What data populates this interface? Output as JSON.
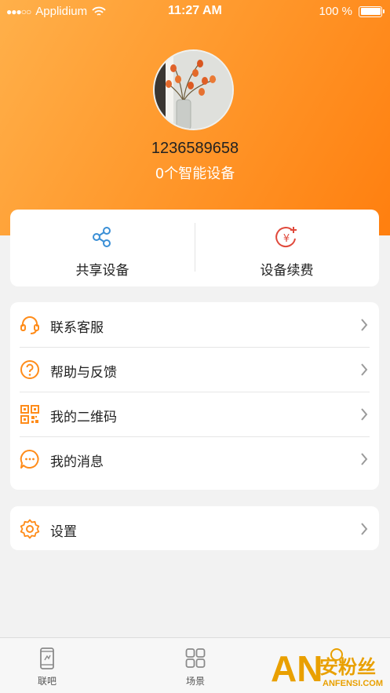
{
  "status_bar": {
    "signal_dots": "●●●○○",
    "carrier": "Applidium",
    "time": "11:27 AM",
    "battery": "100 %",
    "battery_level": 1.0
  },
  "profile": {
    "phone": "1236589658",
    "device_count": "0个智能设备"
  },
  "actions": [
    {
      "label": "共享设备",
      "icon": "share-icon"
    },
    {
      "label": "设备续费",
      "icon": "yuan-recharge-icon"
    }
  ],
  "menu": [
    {
      "label": "联系客服",
      "icon": "headset-icon"
    },
    {
      "label": "帮助与反馈",
      "icon": "help-icon"
    },
    {
      "label": "我的二维码",
      "icon": "qr-code-icon"
    },
    {
      "label": "我的消息",
      "icon": "message-icon"
    }
  ],
  "settings": {
    "label": "设置",
    "icon": "gear-icon"
  },
  "tabs": [
    {
      "label": "联吧",
      "icon": "phone-icon"
    },
    {
      "label": "场景",
      "icon": "grid-icon"
    }
  ],
  "watermark": {
    "text": "AN安粉丝",
    "subtext": "ANFENSI.COM"
  },
  "colors": {
    "accent": "#ff8c1a",
    "header_start": "#ffb04a",
    "header_end": "#ff7f0f",
    "share_blue": "#3a8fd6",
    "recharge_red": "#e0493b"
  }
}
